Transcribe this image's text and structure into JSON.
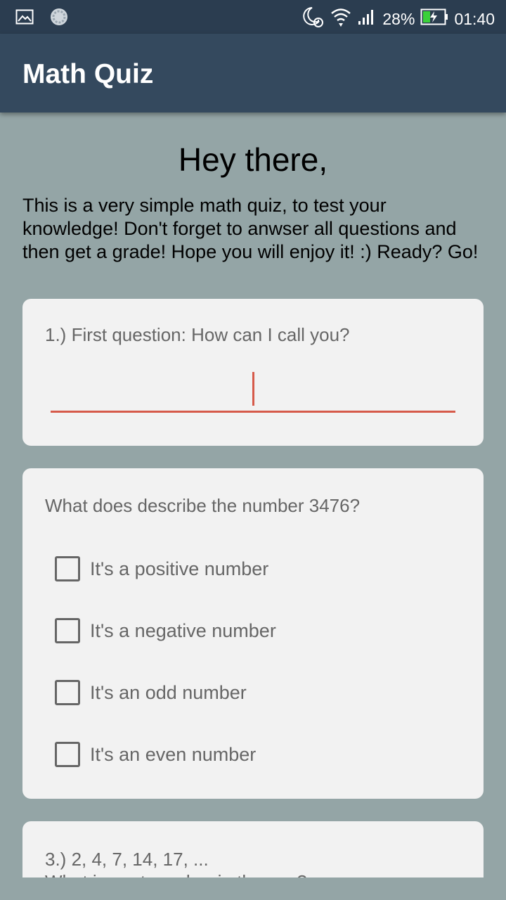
{
  "status_bar": {
    "battery": "28%",
    "time": "01:40"
  },
  "app_bar": {
    "title": "Math Quiz"
  },
  "main": {
    "greeting": "Hey there,",
    "intro": "This is a very simple math quiz, to test your knowledge! Don't forget to anwser all questions and then get a grade! Hope you will enjoy it! :) Ready? Go!"
  },
  "questions": [
    {
      "text": "1.) First question: How can I call you?",
      "input_value": "",
      "input_placeholder": ""
    },
    {
      "text": "What does describe the number 3476?",
      "options": [
        {
          "label": "It's a positive number",
          "checked": false
        },
        {
          "label": "It's a negative number",
          "checked": false
        },
        {
          "label": "It's an odd number",
          "checked": false
        },
        {
          "label": "It's an even number",
          "checked": false
        }
      ]
    },
    {
      "text": "3.) 2, 4, 7, 14, 17, ...",
      "text_line2": "What is next number in the row?"
    }
  ],
  "colors": {
    "background": "#94a5a6",
    "app_bar": "#34495e",
    "status_bar": "#2b3d50",
    "card": "#f2f2f2",
    "accent": "#d65a4a"
  }
}
